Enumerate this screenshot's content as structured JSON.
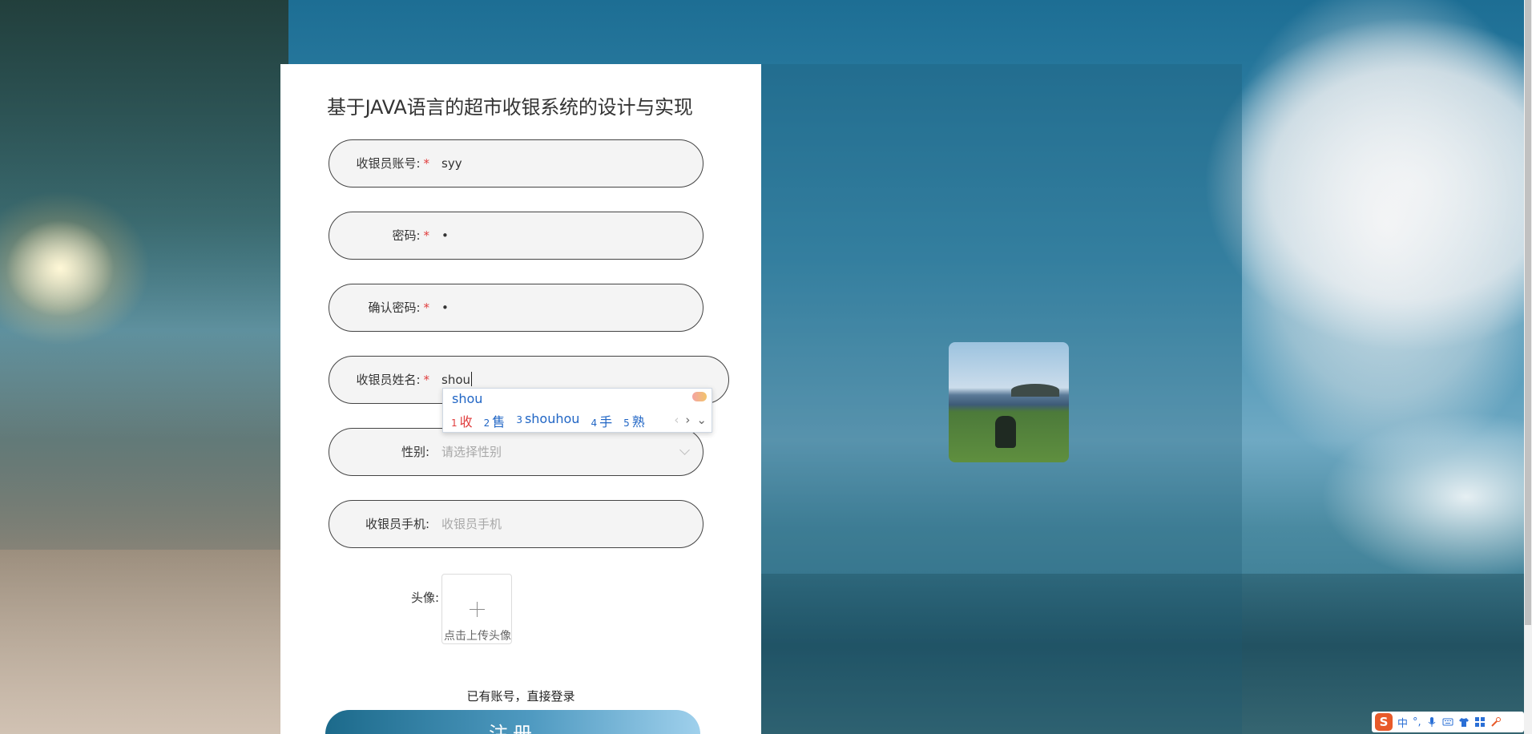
{
  "form": {
    "title": "基于JAVA语言的超市收银系统的设计与实现",
    "fields": [
      {
        "label": "收银员账号:",
        "required": "*",
        "value": "syy"
      },
      {
        "label": "密码:",
        "required": "*",
        "value": "•"
      },
      {
        "label": "确认密码:",
        "required": "*",
        "value": "•"
      },
      {
        "label": "收银员姓名:",
        "required": "*",
        "value": "shou"
      },
      {
        "label": "性别:",
        "required": "",
        "placeholder": "请选择性别"
      },
      {
        "label": "收银员手机:",
        "required": "",
        "placeholder": "收银员手机"
      }
    ],
    "avatar": {
      "label": "头像:",
      "hint": "点击上传头像",
      "plus": "+"
    },
    "login_link": "已有账号，直接登录",
    "submit_label": "注册"
  },
  "ime_popup": {
    "composition": "shou",
    "candidates": [
      {
        "index": "1",
        "text": "收"
      },
      {
        "index": "2",
        "text": "售"
      },
      {
        "index": "3",
        "text": "shouhou"
      },
      {
        "index": "4",
        "text": "手"
      },
      {
        "index": "5",
        "text": "熟"
      }
    ],
    "nav_prev": "‹",
    "nav_next": "›",
    "nav_expand": "⌄"
  },
  "ime_toolbar": {
    "logo": "S",
    "mode": "中",
    "punct": "°,",
    "icons": [
      "mic-icon",
      "keyboard-icon",
      "skin-icon",
      "grid-icon",
      "tools-icon"
    ]
  },
  "colors": {
    "required": "#e03d3d",
    "ime_candidate": "#2166c5",
    "button_gradient_start": "#1c6a8b",
    "button_gradient_end": "#9fd0ec"
  }
}
